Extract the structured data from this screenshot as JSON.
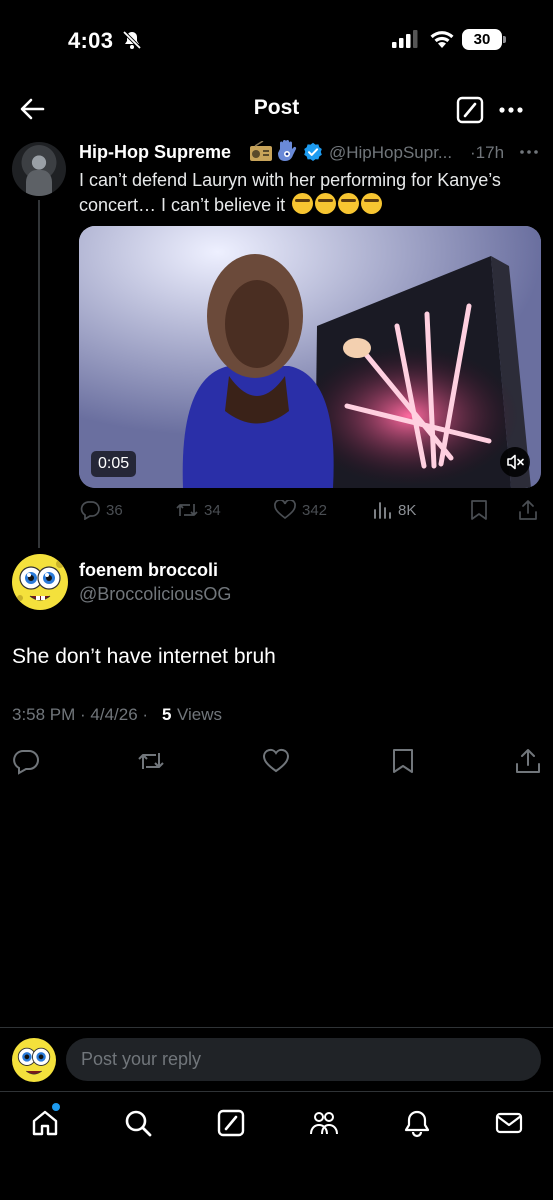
{
  "status_bar": {
    "time": "4:03",
    "battery": "30"
  },
  "header": {
    "title": "Post"
  },
  "quoted_post": {
    "name": "Hip-Hop Supreme",
    "handle": "@HipHopSupr...",
    "separator": "·",
    "time": "17h",
    "text": "I can’t defend Lauryn with her performing for Kanye’s concert… I can’t believe it",
    "video_time": "0:05",
    "stats": {
      "replies": "36",
      "reposts": "34",
      "likes": "342",
      "views": "8K"
    }
  },
  "reply_post": {
    "name": "foenem broccoli",
    "handle": "@BroccoliciousOG",
    "text": "She don’t have internet bruh",
    "timestamp": "3:58 PM · 4/4/26 ·",
    "views_count": "5",
    "views_label": "Views"
  },
  "composer": {
    "placeholder": "Post your reply"
  },
  "tab_bar": {
    "items": [
      "home",
      "search",
      "compose",
      "communities",
      "notifications",
      "messages"
    ]
  },
  "colors": {
    "background": "#000000",
    "accent": "#1d9bf0",
    "secondary_text": "#71767b",
    "input_bg": "#202327"
  }
}
